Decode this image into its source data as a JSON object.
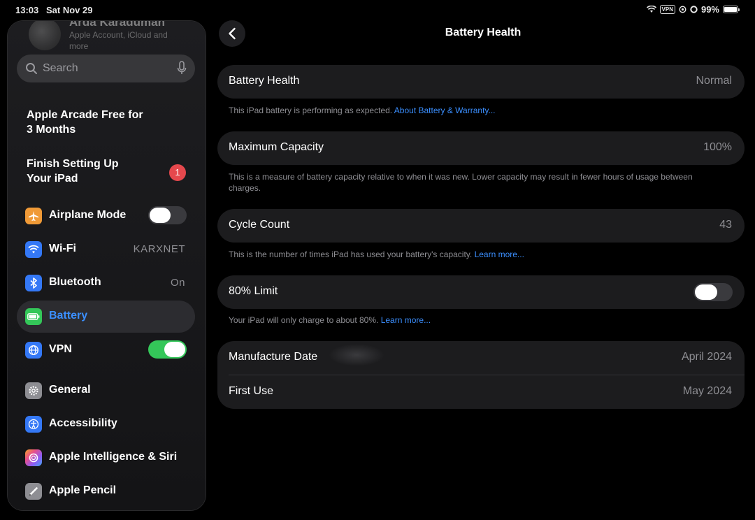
{
  "status_bar": {
    "time": "13:03",
    "date": "Sat Nov 29",
    "vpn": "VPN",
    "battery_percent": "99%"
  },
  "sidebar": {
    "profile": {
      "name": "Arda Karaduman",
      "subtitle": "Apple Account, iCloud and more"
    },
    "search": {
      "placeholder": "Search"
    },
    "promo_arcade": {
      "line1": "Apple Arcade Free for",
      "line2": "3 Months"
    },
    "finish_setup": {
      "line1": "Finish Setting Up",
      "line2": "Your iPad",
      "badge": "1"
    },
    "items": [
      {
        "label": "Airplane Mode",
        "icon": "airplane-icon",
        "color": "#f09a37",
        "toggle": false
      },
      {
        "label": "Wi-Fi",
        "icon": "wifi-icon",
        "color": "#3478f6",
        "value": "KARXNET"
      },
      {
        "label": "Bluetooth",
        "icon": "bluetooth-icon",
        "color": "#3478f6",
        "value": "On"
      },
      {
        "label": "Battery",
        "icon": "battery-icon",
        "color": "#34c759",
        "selected": true
      },
      {
        "label": "VPN",
        "icon": "vpn-globe-icon",
        "color": "#3478f6",
        "toggle": true
      },
      {
        "label": "General",
        "icon": "gear-icon",
        "color": "#8e8e93"
      },
      {
        "label": "Accessibility",
        "icon": "accessibility-icon",
        "color": "#3478f6"
      },
      {
        "label": "Apple Intelligence & Siri",
        "icon": "siri-icon",
        "color": "#c86dd7"
      },
      {
        "label": "Apple Pencil",
        "icon": "pencil-icon",
        "color": "#8e8e93"
      }
    ]
  },
  "main": {
    "title": "Battery Health",
    "battery_health": {
      "label": "Battery Health",
      "value": "Normal",
      "caption": "This iPad battery is performing as expected.",
      "link": "About Battery & Warranty..."
    },
    "max_capacity": {
      "label": "Maximum Capacity",
      "value": "100%",
      "caption": "This is a measure of battery capacity relative to when it was new. Lower capacity may result in fewer hours of usage between charges."
    },
    "cycle_count": {
      "label": "Cycle Count",
      "value": "43",
      "caption": "This is the number of times iPad has used your battery's capacity.",
      "link": "Learn more..."
    },
    "limit_80": {
      "label": "80% Limit",
      "toggle": false,
      "caption": "Your iPad will only charge to about 80%.",
      "link": "Learn more..."
    },
    "manufacture_date": {
      "label": "Manufacture Date",
      "value": "April 2024"
    },
    "first_use": {
      "label": "First Use",
      "value": "May 2024"
    }
  },
  "colors": {
    "accent": "#3b8fff",
    "toggle_on": "#34c759",
    "card_bg": "#1c1c1e",
    "badge_red": "#e5484d"
  }
}
